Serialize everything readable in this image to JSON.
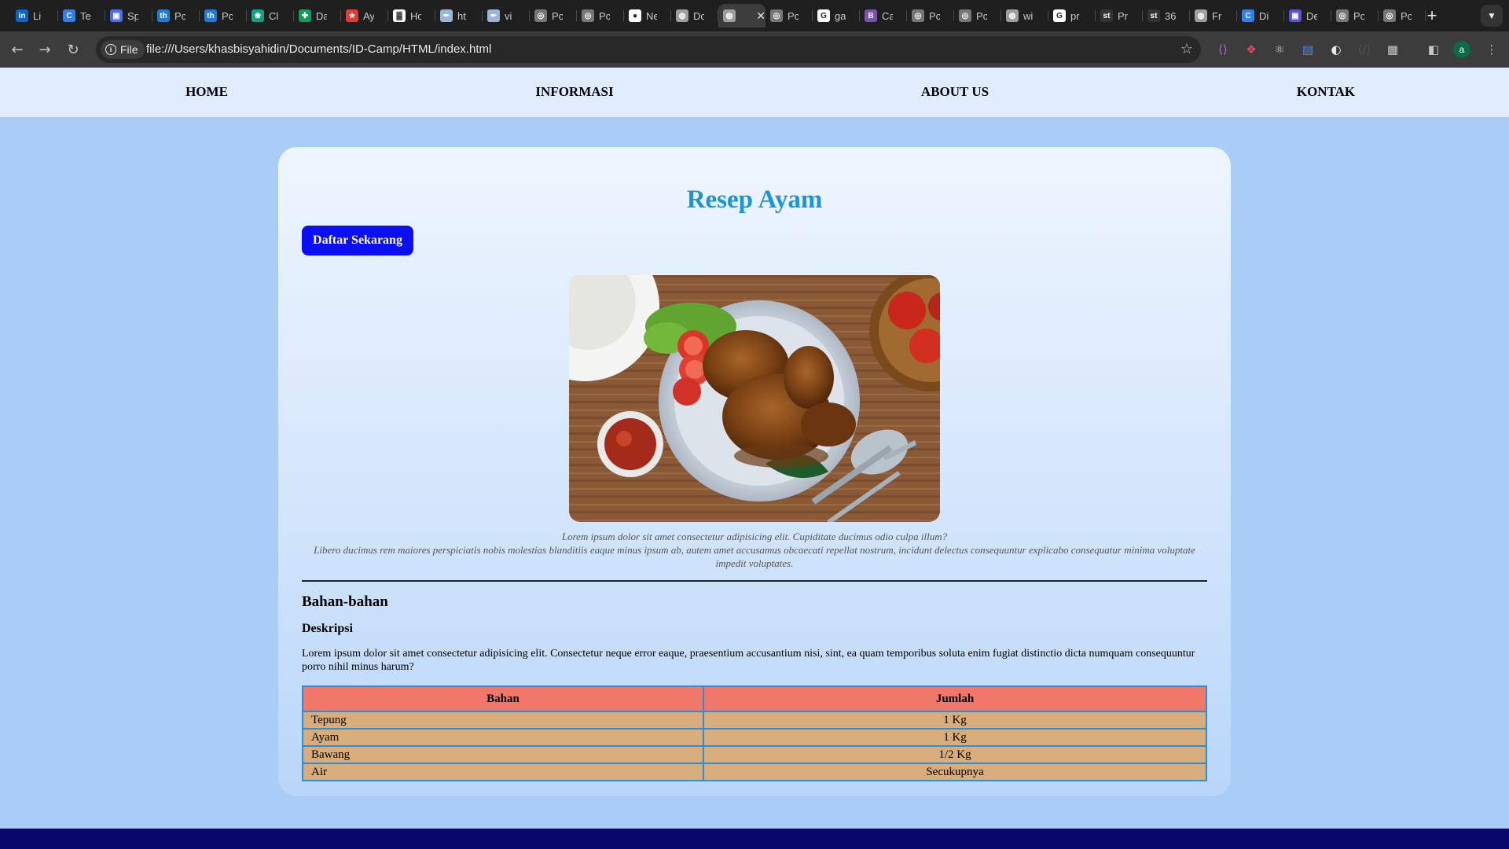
{
  "browser": {
    "tabs": [
      {
        "label": "Li",
        "icon": "linkedin-icon",
        "color": "#0a66c2"
      },
      {
        "label": "Te",
        "icon": "c-logo-icon",
        "color": "#2f80ed"
      },
      {
        "label": "Sp",
        "icon": "app-icon",
        "color": "#4f6bed"
      },
      {
        "label": "Pc",
        "icon": "th-icon",
        "color": "#1e7bd8"
      },
      {
        "label": "Pc",
        "icon": "th-icon",
        "color": "#1e7bd8"
      },
      {
        "label": "Cl",
        "icon": "chatgpt-icon",
        "color": "#10a37f"
      },
      {
        "label": "Da",
        "icon": "sheets-icon",
        "color": "#0f9d58"
      },
      {
        "label": "Ay",
        "icon": "recipe-icon",
        "color": "#e53935"
      },
      {
        "label": "Hc",
        "icon": "chart-icon",
        "color": "#ffffff"
      },
      {
        "label": "ht",
        "icon": "wiki-icon",
        "color": "#9ab6d8"
      },
      {
        "label": "vi",
        "icon": "wiki-icon",
        "color": "#9ab6d8"
      },
      {
        "label": "Pc",
        "icon": "radio-icon",
        "color": "#777777"
      },
      {
        "label": "Pc",
        "icon": "radio-icon",
        "color": "#777777"
      },
      {
        "label": "Ne",
        "icon": "github-icon",
        "color": "#ffffff"
      },
      {
        "label": "Dc",
        "icon": "globe-icon",
        "color": "#9e9e9e"
      },
      {
        "label": "",
        "icon": "globe-icon",
        "color": "#9e9e9e",
        "active": true
      },
      {
        "label": "Pc",
        "icon": "radio-icon",
        "color": "#777777"
      },
      {
        "label": "ga",
        "icon": "google-icon",
        "color": "#ffffff"
      },
      {
        "label": "Ca",
        "icon": "bootstrap-icon",
        "color": "#7952b3"
      },
      {
        "label": "Pc",
        "icon": "radio-icon",
        "color": "#777777"
      },
      {
        "label": "Pc",
        "icon": "radio-icon",
        "color": "#777777"
      },
      {
        "label": "wi",
        "icon": "globe-icon",
        "color": "#9e9e9e"
      },
      {
        "label": "pr",
        "icon": "google-icon",
        "color": "#ffffff"
      },
      {
        "label": "Pr",
        "icon": "st-icon",
        "color": "#333333"
      },
      {
        "label": "36",
        "icon": "st-icon",
        "color": "#333333"
      },
      {
        "label": "Fr",
        "icon": "globe-icon",
        "color": "#9e9e9e"
      },
      {
        "label": "Di",
        "icon": "c-logo-icon",
        "color": "#2f80ed"
      },
      {
        "label": "De",
        "icon": "app-icon",
        "color": "#5b4fe0"
      },
      {
        "label": "Pc",
        "icon": "radio-icon",
        "color": "#777777"
      },
      {
        "label": "Pc",
        "icon": "radio-icon",
        "color": "#777777"
      }
    ],
    "new_tab_label": "+",
    "site_chip": "File",
    "url": "file:///Users/khasbisyahidin/Documents/ID-Camp/HTML/index.html",
    "profile_initial": "a"
  },
  "nav": {
    "home": "HOME",
    "info": "INFORMASI",
    "about": "ABOUT US",
    "contact": "KONTAK"
  },
  "main": {
    "title": "Resep Ayam",
    "cta": "Daftar Sekarang",
    "image_alt": "fried-chicken-photo",
    "caption_line1": "Lorem ipsum dolor sit amet consectetur adipisicing elit. Cupiditate ducimus odio culpa illum?",
    "caption_line2": "Libero ducimus rem maiores perspiciatis nobis molestias blanditiis eaque minus ipsum ab, autem amet accusamus obcaecati repellat nostrum, incidunt delectus consequuntur explicabo consequatur minima voluptate impedit voluptates.",
    "section_title": "Bahan-bahan",
    "subsection_title": "Deskripsi",
    "description": "Lorem ipsum dolor sit amet consectetur adipisicing elit. Consectetur neque error eaque, praesentium accusantium nisi, sint, ea quam temporibus soluta enim fugiat distinctio dicta numquam consequuntur porro nihil minus harum?",
    "table": {
      "headers": [
        "Bahan",
        "Jumlah"
      ],
      "rows": [
        [
          "Tepung",
          "1 Kg"
        ],
        [
          "Ayam",
          "1 Kg"
        ],
        [
          "Bawang",
          "1/2 Kg"
        ],
        [
          "Air",
          "Secukupnya"
        ]
      ]
    }
  },
  "colors": {
    "page_bg": "#aacdf8",
    "nav_bg": "#dfecfd",
    "title": "#1a96d8",
    "cta_bg": "#0b0ef0",
    "table_header": "#f1776b",
    "table_cell": "#d8ad7b",
    "table_border": "#2a8fd6",
    "footer": "#07076c"
  }
}
